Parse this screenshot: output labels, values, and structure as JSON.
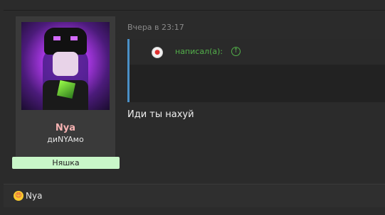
{
  "post": {
    "timestamp": "Вчера в 23:17",
    "quote_label": "написал(а):",
    "message": "Иди ты нахуй"
  },
  "user": {
    "name": "Nya",
    "title": "диNYAмо",
    "banner": "Няшка"
  },
  "reactions": {
    "emoji": "😍",
    "users": "Nya"
  },
  "icons": {
    "quote_author_icon": "clown-face-icon",
    "jump_to_quote_icon": "arrow-up-circle-icon",
    "reaction_icon": "heart-eyes-emoji-icon"
  },
  "colors": {
    "background": "#2b2b2b",
    "username": "#f6b2b2",
    "banner_bg": "#c9f7c9",
    "quote_border": "#4a90c7",
    "quote_label": "#53b04a",
    "timestamp": "#8a8a8a"
  }
}
